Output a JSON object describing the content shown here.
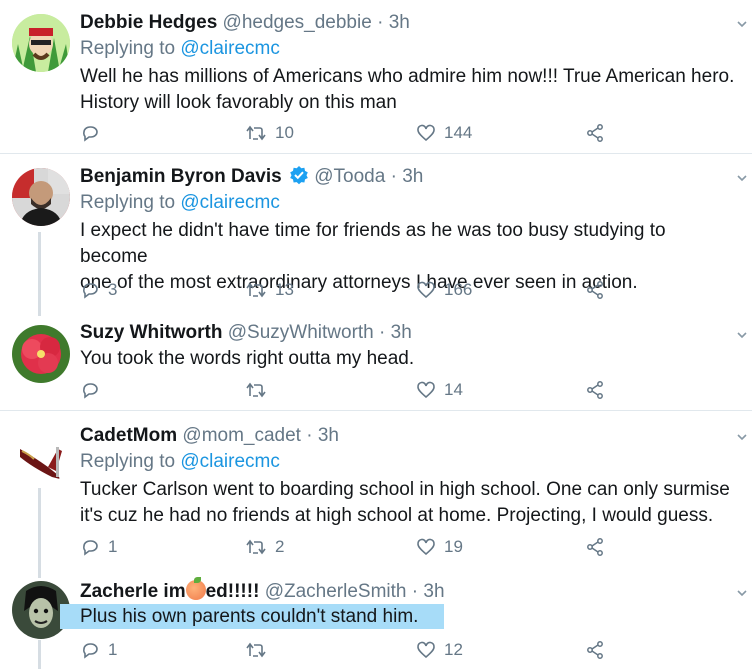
{
  "tweets": [
    {
      "name": "Debbie Hedges",
      "handle": "@hedges_debbie",
      "dot": "·",
      "time": "3h",
      "replying_prefix": "Replying to",
      "replying_to": "@clairecmc",
      "text_lines": [
        "Well he has millions of Americans who admire him now!!! True American hero.",
        "History will look favorably on this man"
      ],
      "replies": "",
      "retweets": "10",
      "likes": "144"
    },
    {
      "name": "Benjamin Byron Davis",
      "verified": true,
      "handle": "@Tooda",
      "dot": "·",
      "time": "3h",
      "replying_prefix": "Replying to",
      "replying_to": "@clairecmc",
      "text_lines": [
        "I expect he didn't have time for friends as he was too busy studying to become",
        "one of the most extraordinary attorneys I have ever seen in action."
      ],
      "replies": "3",
      "retweets": "13",
      "likes": "166"
    },
    {
      "name": "Suzy Whitworth",
      "handle": "@SuzyWhitworth",
      "dot": "·",
      "time": "3h",
      "text_lines": [
        "You took the words right outta my head."
      ],
      "replies": "",
      "retweets": "",
      "likes": "14"
    },
    {
      "name": "CadetMom",
      "handle": "@mom_cadet",
      "dot": "·",
      "time": "3h",
      "replying_prefix": "Replying to",
      "replying_to": "@clairecmc",
      "text_lines": [
        "Tucker Carlson went to boarding school in high school. One can only surmise",
        "it's cuz he had no friends at high school at home. Projecting, I would guess."
      ],
      "replies": "1",
      "retweets": "2",
      "likes": "19"
    },
    {
      "name_before": "Zacherle im",
      "name_after": "ed!!!!!",
      "handle": "@ZacherleSmith",
      "dot": "·",
      "time": "3h",
      "text_lines": [
        "Plus his own parents couldn't stand him."
      ],
      "replies": "1",
      "retweets": "",
      "likes": "12"
    }
  ],
  "colors": {
    "text": "#14171a",
    "muted": "#657786",
    "link": "#1b95e0",
    "divider": "#e1e8ed",
    "highlight": "#a7dcf8",
    "verified": "#1da1f2"
  },
  "icons": [
    "reply-icon",
    "retweet-icon",
    "like-icon",
    "share-icon",
    "chevron-down-icon",
    "verified-badge-icon"
  ]
}
